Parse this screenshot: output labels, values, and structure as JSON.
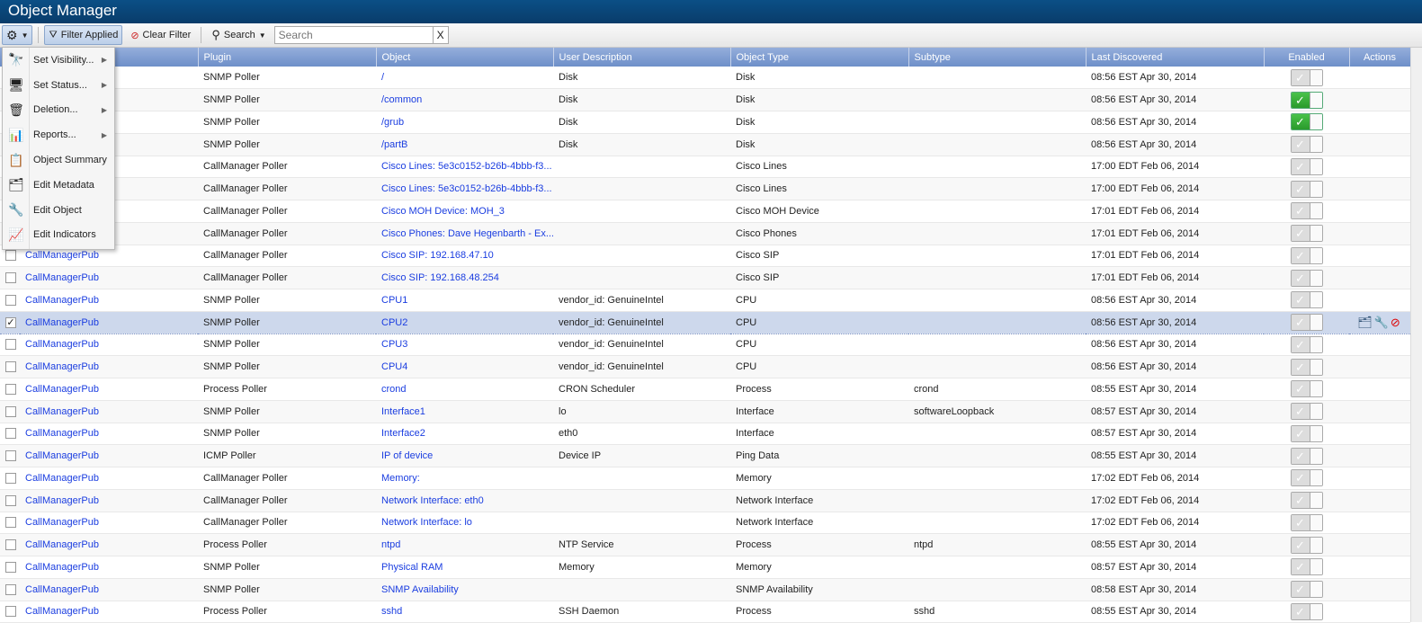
{
  "window": {
    "title": "Object Manager"
  },
  "toolbar": {
    "settings_icon": "gear-icon",
    "filter_applied": "Filter Applied",
    "clear_filter": "Clear Filter",
    "search_label": "Search",
    "search_placeholder": "Search",
    "search_value": "",
    "clear_search": "X"
  },
  "menu": {
    "items": [
      {
        "label": "Set Visibility...",
        "icon": "binoculars-icon",
        "submenu": true
      },
      {
        "label": "Set Status...",
        "icon": "status-icon",
        "submenu": true
      },
      {
        "label": "Deletion...",
        "icon": "trash-icon",
        "submenu": true
      },
      {
        "label": "Reports...",
        "icon": "reports-icon",
        "submenu": true
      },
      {
        "label": "Object Summary",
        "icon": "summary-icon",
        "submenu": false
      },
      {
        "label": "Edit Metadata",
        "icon": "metadata-icon",
        "submenu": false
      },
      {
        "label": "Edit Object",
        "icon": "wrench-icon",
        "submenu": false
      },
      {
        "label": "Edit Indicators",
        "icon": "indicators-icon",
        "submenu": false
      }
    ]
  },
  "table": {
    "columns": [
      "",
      "",
      "Plugin",
      "Object",
      "User Description",
      "Object Type",
      "Subtype",
      "Last Discovered",
      "Enabled",
      "Actions"
    ],
    "rows": [
      {
        "device": "",
        "plugin": "SNMP Poller",
        "object": "/",
        "desc": "Disk",
        "type": "Disk",
        "subtype": "",
        "last": "08:56 EST Apr 30, 2014",
        "enabled": false
      },
      {
        "device": "",
        "plugin": "SNMP Poller",
        "object": "/common",
        "desc": "Disk",
        "type": "Disk",
        "subtype": "",
        "last": "08:56 EST Apr 30, 2014",
        "enabled": true
      },
      {
        "device": "",
        "plugin": "SNMP Poller",
        "object": "/grub",
        "desc": "Disk",
        "type": "Disk",
        "subtype": "",
        "last": "08:56 EST Apr 30, 2014",
        "enabled": true
      },
      {
        "device": "",
        "plugin": "SNMP Poller",
        "object": "/partB",
        "desc": "Disk",
        "type": "Disk",
        "subtype": "",
        "last": "08:56 EST Apr 30, 2014",
        "enabled": false
      },
      {
        "device": "",
        "plugin": "CallManager Poller",
        "object": "Cisco Lines: 5e3c0152-b26b-4bbb-f3...",
        "desc": "",
        "type": "Cisco Lines",
        "subtype": "",
        "last": "17:00 EDT Feb 06, 2014",
        "enabled": false
      },
      {
        "device": "",
        "plugin": "CallManager Poller",
        "object": "Cisco Lines: 5e3c0152-b26b-4bbb-f3...",
        "desc": "",
        "type": "Cisco Lines",
        "subtype": "",
        "last": "17:00 EDT Feb 06, 2014",
        "enabled": false
      },
      {
        "device": "",
        "plugin": "CallManager Poller",
        "object": "Cisco MOH Device: MOH_3",
        "desc": "",
        "type": "Cisco MOH Device",
        "subtype": "",
        "last": "17:01 EDT Feb 06, 2014",
        "enabled": false
      },
      {
        "device": "",
        "plugin": "CallManager Poller",
        "object": "Cisco Phones: Dave Hegenbarth - Ex...",
        "desc": "",
        "type": "Cisco Phones",
        "subtype": "",
        "last": "17:01 EDT Feb 06, 2014",
        "enabled": false
      },
      {
        "device": "CallManagerPub",
        "plugin": "CallManager Poller",
        "object": "Cisco SIP: 192.168.47.10",
        "desc": "",
        "type": "Cisco SIP",
        "subtype": "",
        "last": "17:01 EDT Feb 06, 2014",
        "enabled": false
      },
      {
        "device": "CallManagerPub",
        "plugin": "CallManager Poller",
        "object": "Cisco SIP: 192.168.48.254",
        "desc": "",
        "type": "Cisco SIP",
        "subtype": "",
        "last": "17:01 EDT Feb 06, 2014",
        "enabled": false
      },
      {
        "device": "CallManagerPub",
        "plugin": "SNMP Poller",
        "object": "CPU1",
        "desc": "vendor_id: GenuineIntel",
        "type": "CPU",
        "subtype": "",
        "last": "08:56 EST Apr 30, 2014",
        "enabled": false
      },
      {
        "device": "CallManagerPub",
        "plugin": "SNMP Poller",
        "object": "CPU2",
        "desc": "vendor_id: GenuineIntel",
        "type": "CPU",
        "subtype": "",
        "last": "08:56 EST Apr 30, 2014",
        "enabled": false,
        "selected": true
      },
      {
        "device": "CallManagerPub",
        "plugin": "SNMP Poller",
        "object": "CPU3",
        "desc": "vendor_id: GenuineIntel",
        "type": "CPU",
        "subtype": "",
        "last": "08:56 EST Apr 30, 2014",
        "enabled": false
      },
      {
        "device": "CallManagerPub",
        "plugin": "SNMP Poller",
        "object": "CPU4",
        "desc": "vendor_id: GenuineIntel",
        "type": "CPU",
        "subtype": "",
        "last": "08:56 EST Apr 30, 2014",
        "enabled": false
      },
      {
        "device": "CallManagerPub",
        "plugin": "Process Poller",
        "object": "crond",
        "desc": "CRON Scheduler",
        "type": "Process",
        "subtype": "crond",
        "last": "08:55 EST Apr 30, 2014",
        "enabled": false
      },
      {
        "device": "CallManagerPub",
        "plugin": "SNMP Poller",
        "object": "Interface1",
        "desc": "lo",
        "type": "Interface",
        "subtype": "softwareLoopback",
        "last": "08:57 EST Apr 30, 2014",
        "enabled": false
      },
      {
        "device": "CallManagerPub",
        "plugin": "SNMP Poller",
        "object": "Interface2",
        "desc": "eth0",
        "type": "Interface",
        "subtype": "",
        "last": "08:57 EST Apr 30, 2014",
        "enabled": false
      },
      {
        "device": "CallManagerPub",
        "plugin": "ICMP Poller",
        "object": "IP of device",
        "desc": "Device IP",
        "type": "Ping Data",
        "subtype": "",
        "last": "08:55 EST Apr 30, 2014",
        "enabled": false
      },
      {
        "device": "CallManagerPub",
        "plugin": "CallManager Poller",
        "object": "Memory:",
        "desc": "",
        "type": "Memory",
        "subtype": "",
        "last": "17:02 EDT Feb 06, 2014",
        "enabled": false
      },
      {
        "device": "CallManagerPub",
        "plugin": "CallManager Poller",
        "object": "Network Interface: eth0",
        "desc": "",
        "type": "Network Interface",
        "subtype": "",
        "last": "17:02 EDT Feb 06, 2014",
        "enabled": false
      },
      {
        "device": "CallManagerPub",
        "plugin": "CallManager Poller",
        "object": "Network Interface: lo",
        "desc": "",
        "type": "Network Interface",
        "subtype": "",
        "last": "17:02 EDT Feb 06, 2014",
        "enabled": false
      },
      {
        "device": "CallManagerPub",
        "plugin": "Process Poller",
        "object": "ntpd",
        "desc": "NTP Service",
        "type": "Process",
        "subtype": "ntpd",
        "last": "08:55 EST Apr 30, 2014",
        "enabled": false
      },
      {
        "device": "CallManagerPub",
        "plugin": "SNMP Poller",
        "object": "Physical RAM",
        "desc": "Memory",
        "type": "Memory",
        "subtype": "",
        "last": "08:57 EST Apr 30, 2014",
        "enabled": false
      },
      {
        "device": "CallManagerPub",
        "plugin": "SNMP Poller",
        "object": "SNMP Availability",
        "desc": "",
        "type": "SNMP Availability",
        "subtype": "",
        "last": "08:58 EST Apr 30, 2014",
        "enabled": false
      },
      {
        "device": "CallManagerPub",
        "plugin": "Process Poller",
        "object": "sshd",
        "desc": "SSH Daemon",
        "type": "Process",
        "subtype": "sshd",
        "last": "08:55 EST Apr 30, 2014",
        "enabled": false
      }
    ],
    "row_actions": [
      "edit-metadata-icon",
      "wrench-icon",
      "delete-icon"
    ]
  },
  "colors": {
    "title_bg": "#0b4f86",
    "header_bg": "#6d8fc9",
    "link": "#1a3de0",
    "enabled_on": "#2a9a2c",
    "selected_row": "#cdd8ec"
  }
}
